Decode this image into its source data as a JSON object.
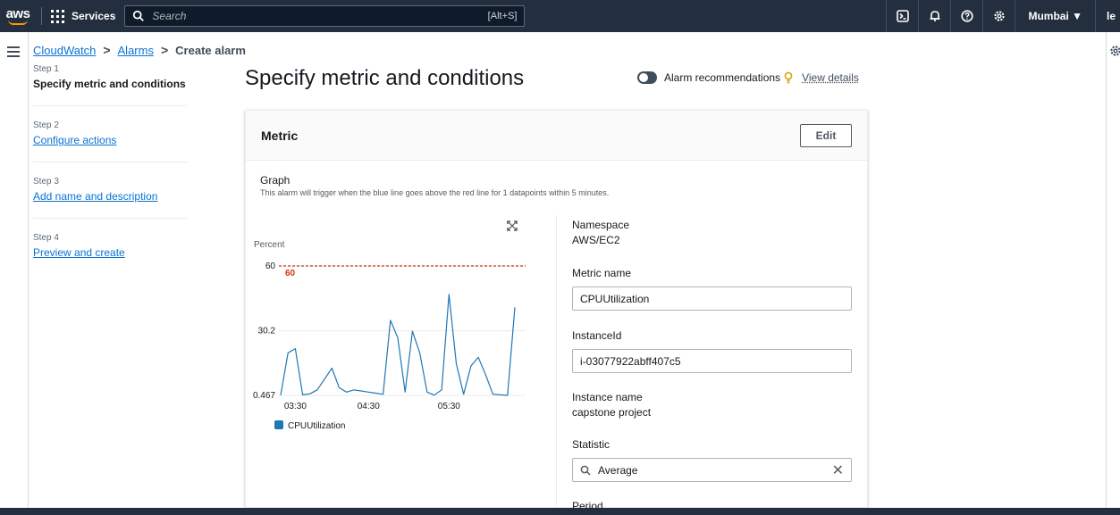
{
  "topnav": {
    "logo": "aws",
    "services_label": "Services",
    "search_placeholder": "Search",
    "search_shortcut": "[Alt+S]",
    "region": "Mumbai ▼",
    "user": "le"
  },
  "breadcrumb": {
    "items": [
      "CloudWatch",
      "Alarms",
      "Create alarm"
    ]
  },
  "steps": [
    {
      "number": "Step 1",
      "title": "Specify metric and conditions"
    },
    {
      "number": "Step 2",
      "title": "Configure actions"
    },
    {
      "number": "Step 3",
      "title": "Add name and description"
    },
    {
      "number": "Step 4",
      "title": "Preview and create"
    }
  ],
  "page": {
    "title": "Specify metric and conditions",
    "recommendations_label": "Alarm recommendations",
    "view_details": "View details"
  },
  "metric_card": {
    "title": "Metric",
    "edit_label": "Edit",
    "graph_label": "Graph",
    "graph_desc": "This alarm will trigger when the blue line goes above the red line for 1 datapoints within 5 minutes."
  },
  "details": {
    "namespace_label": "Namespace",
    "namespace_value": "AWS/EC2",
    "metric_name_label": "Metric name",
    "metric_name_value": "CPUUtilization",
    "instance_id_label": "InstanceId",
    "instance_id_value": "i-03077922abff407c5",
    "instance_name_label": "Instance name",
    "instance_name_value": "capstone project",
    "statistic_label": "Statistic",
    "statistic_value": "Average",
    "period_label": "Period"
  },
  "chart_data": {
    "type": "line",
    "ylabel": "Percent",
    "yticks": [
      "60",
      "30.2",
      "0.467"
    ],
    "ylim": [
      0.467,
      60
    ],
    "xticks": [
      "03:30",
      "04:30",
      "05:30"
    ],
    "threshold": 60,
    "threshold_label": "60",
    "threshold_color": "#d13212",
    "series": [
      {
        "name": "CPUUtilization",
        "color": "#1f77b4",
        "values": [
          0.5,
          20,
          22,
          0.7,
          1.2,
          3,
          8,
          13,
          4,
          2,
          3,
          2.5,
          2,
          1.5,
          1,
          35,
          27,
          2,
          30,
          20,
          2,
          0.6,
          3,
          47,
          15,
          1,
          14,
          18,
          10,
          1,
          0.7,
          0.5,
          41
        ]
      }
    ]
  }
}
